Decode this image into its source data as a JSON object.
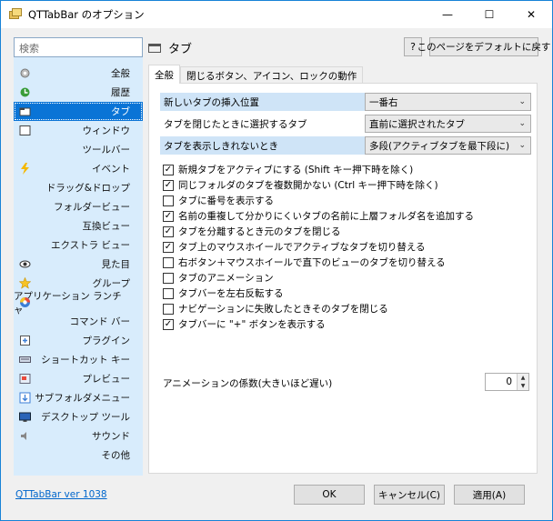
{
  "window": {
    "title": "QTTabBar のオプション",
    "controls": {
      "minimize": "—",
      "maximize": "☐",
      "close": "✕"
    }
  },
  "sidebar": {
    "search_placeholder": "検索",
    "items": [
      {
        "label": "全般",
        "icon": "gear-icon"
      },
      {
        "label": "履歴",
        "icon": "history-icon"
      },
      {
        "label": "タブ",
        "icon": "tab-icon",
        "selected": true
      },
      {
        "label": "ウィンドウ",
        "icon": "window-icon"
      },
      {
        "label": "ツールバー",
        "icon": ""
      },
      {
        "label": "イベント",
        "icon": "lightning-icon"
      },
      {
        "label": "ドラッグ&ドロップ",
        "icon": ""
      },
      {
        "label": "フォルダービュー",
        "icon": ""
      },
      {
        "label": "互換ビュー",
        "icon": ""
      },
      {
        "label": "エクストラ ビュー",
        "icon": ""
      },
      {
        "label": "見た目",
        "icon": "eye-icon"
      },
      {
        "label": "グループ",
        "icon": "star-icon"
      },
      {
        "label": "アプリケーション ランチャ",
        "icon": "launcher-icon"
      },
      {
        "label": "コマンド バー",
        "icon": ""
      },
      {
        "label": "プラグイン",
        "icon": "plugin-icon"
      },
      {
        "label": "ショートカット キー",
        "icon": "keyboard-icon"
      },
      {
        "label": "プレビュー",
        "icon": "preview-icon"
      },
      {
        "label": "サブフォルダメニュー",
        "icon": "subfolder-icon"
      },
      {
        "label": "デスクトップ ツール",
        "icon": "desktop-icon"
      },
      {
        "label": "サウンド",
        "icon": "speaker-icon"
      },
      {
        "label": "その他",
        "icon": ""
      }
    ]
  },
  "page": {
    "title": "タブ",
    "help_label": "?",
    "reset_label": "このページをデフォルトに戻す",
    "tabs": [
      "全般",
      "閉じるボタン、アイコン、ロックの動作"
    ]
  },
  "settings": [
    {
      "label": "新しいタブの挿入位置",
      "value": "一番右"
    },
    {
      "label": "タブを閉じたときに選択するタブ",
      "value": "直前に選択されたタブ"
    },
    {
      "label": "タブを表示しきれないとき",
      "value": "多段(アクティブタブを最下段に)"
    }
  ],
  "checkboxes": [
    {
      "label": "新規タブをアクティブにする (Shift キー押下時を除く)",
      "checked": "✓"
    },
    {
      "label": "同じフォルダのタブを複数開かない (Ctrl キー押下時を除く)",
      "checked": "✓"
    },
    {
      "label": "タブに番号を表示する",
      "checked": ""
    },
    {
      "label": "名前の重複して分かりにくいタブの名前に上層フォルダ名を追加する",
      "checked": "✓"
    },
    {
      "label": "タブを分離するとき元のタブを閉じる",
      "checked": "✓"
    },
    {
      "label": "タブ上のマウスホイールでアクティブなタブを切り替える",
      "checked": "✓"
    },
    {
      "label": "右ボタン＋マウスホイールで直下のビューのタブを切り替える",
      "checked": ""
    },
    {
      "label": "タブのアニメーション",
      "checked": ""
    },
    {
      "label": "タブバーを左右反転する",
      "checked": ""
    },
    {
      "label": "ナビゲーションに失敗したときそのタブを閉じる",
      "checked": ""
    },
    {
      "label": "タブバーに \"+\" ボタンを表示する",
      "checked": "✓"
    }
  ],
  "animation": {
    "label": "アニメーションの係数(大きいほど遅い)",
    "value": "0"
  },
  "footer": {
    "version_link": "QTTabBar ver 1038",
    "ok": "OK",
    "cancel": "キャンセル(C)",
    "apply": "適用(A)"
  }
}
